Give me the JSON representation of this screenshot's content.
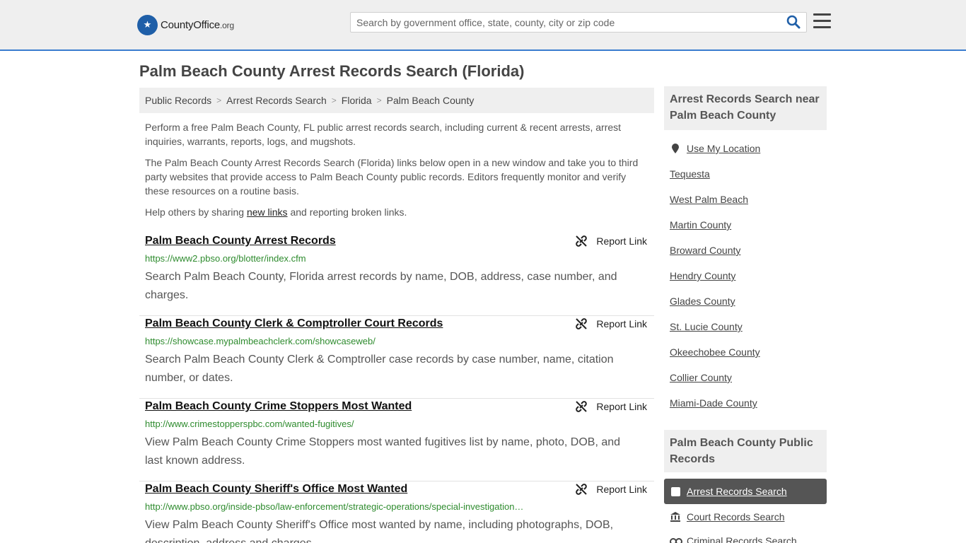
{
  "header": {
    "logo_text": "CountyOffice",
    "logo_tld": ".org",
    "search_placeholder": "Search by government office, state, county, city or zip code"
  },
  "page_title": "Palm Beach County Arrest Records Search (Florida)",
  "breadcrumb": [
    "Public Records",
    "Arrest Records Search",
    "Florida",
    "Palm Beach County"
  ],
  "intro": {
    "p1": "Perform a free Palm Beach County, FL public arrest records search, including current & recent arrests, arrest inquiries, warrants, reports, logs, and mugshots.",
    "p2": "The Palm Beach County Arrest Records Search (Florida) links below open in a new window and take you to third party websites that provide access to Palm Beach County public records. Editors frequently monitor and verify these resources on a routine basis.",
    "p3_before": "Help others by sharing ",
    "p3_link": "new links",
    "p3_after": " and reporting broken links."
  },
  "report_label": "Report Link",
  "results": [
    {
      "title": "Palm Beach County Arrest Records",
      "url": "https://www2.pbso.org/blotter/index.cfm",
      "desc": "Search Palm Beach County, Florida arrest records by name, DOB, address, case number, and charges."
    },
    {
      "title": "Palm Beach County Clerk & Comptroller Court Records",
      "url": "https://showcase.mypalmbeachclerk.com/showcaseweb/",
      "desc": "Search Palm Beach County Clerk & Comptroller case records by case number, name, citation number, or dates."
    },
    {
      "title": "Palm Beach County Crime Stoppers Most Wanted",
      "url": "http://www.crimestopperspbc.com/wanted-fugitives/",
      "desc": "View Palm Beach County Crime Stoppers most wanted fugitives list by name, photo, DOB, and last known address."
    },
    {
      "title": "Palm Beach County Sheriff's Office Most Wanted",
      "url": "http://www.pbso.org/inside-pbso/law-enforcement/strategic-operations/special-investigation…",
      "desc": "View Palm Beach County Sheriff's Office most wanted by name, including photographs, DOB, description, address and charges."
    }
  ],
  "sidebar": {
    "nearby_heading": "Arrest Records Search near Palm Beach County",
    "use_location": "Use My Location",
    "nearby": [
      "Tequesta",
      "West Palm Beach",
      "Martin County",
      "Broward County",
      "Hendry County",
      "Glades County",
      "St. Lucie County",
      "Okeechobee County",
      "Collier County",
      "Miami-Dade County"
    ],
    "public_heading": "Palm Beach County Public Records",
    "public_active": "Arrest Records Search",
    "public_items": [
      "Court Records Search",
      "Criminal Records Search"
    ]
  },
  "colors": {
    "accent": "#3a7ccf",
    "url_green": "#2e8b2e",
    "active_bg": "#555555"
  }
}
